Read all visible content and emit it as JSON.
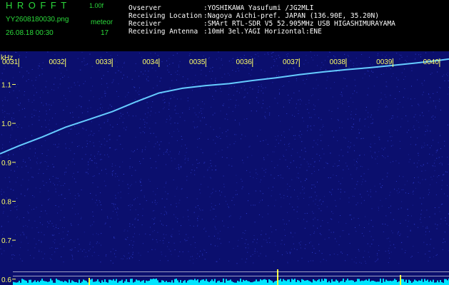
{
  "header": {
    "app_title": "HROFFT",
    "version": "1.00f",
    "filename": "YY2608180030.png",
    "datetime": "26.08.18 00:30",
    "mode_label": "meteor",
    "count": "17"
  },
  "info": [
    {
      "label": "Ovserver",
      "value": ":YOSHIKAWA Yasufumi /JG2MLI"
    },
    {
      "label": "Receiving Location",
      "value": ":Nagoya Aichi-pref. JAPAN (136.90E, 35.20N)"
    },
    {
      "label": "Receiver",
      "value": ":SMArt RTL-SDR V5 52.905MHz USB HIGASHIMURAYAMA"
    },
    {
      "label": "Receiving Antenna",
      "value": ":10mH 3el.YAGI Horizontal:ENE"
    }
  ],
  "colors": {
    "background": "#000000",
    "plot_background": "#0b0f6e",
    "noise": "#3344dd",
    "trace": "#66ccff",
    "axis_text": "#ffff66",
    "header_green": "#2bd93b",
    "header_white": "#ffffff",
    "spectrum": "#00e5ff",
    "spectrum_peak": "#ffff33"
  },
  "chart_data": {
    "type": "line",
    "ylabel": "kHz",
    "yticks": [
      "1.1",
      "1.0",
      "0.9",
      "0.8",
      "0.7",
      "0.6"
    ],
    "ylim": [
      0.585,
      1.185
    ],
    "xticks": [
      "0031",
      "0032",
      "0033",
      "0034",
      "0035",
      "0036",
      "0037",
      "0038",
      "0039",
      "0040"
    ],
    "xlim": [
      30.6,
      40.2
    ],
    "series": [
      {
        "x": [
          30.6,
          31.0,
          31.5,
          32.0,
          32.5,
          33.0,
          33.5,
          34.0,
          34.5,
          35.0,
          35.5,
          36.0,
          36.5,
          37.0,
          37.5,
          38.0,
          38.5,
          39.0,
          39.5,
          40.0,
          40.2
        ],
        "y": [
          0.922,
          0.942,
          0.965,
          0.99,
          1.01,
          1.03,
          1.055,
          1.078,
          1.09,
          1.097,
          1.102,
          1.11,
          1.117,
          1.125,
          1.132,
          1.138,
          1.143,
          1.149,
          1.155,
          1.162,
          1.165
        ]
      }
    ],
    "grid": false,
    "horizontal_lines": [
      0.619,
      0.608
    ]
  }
}
